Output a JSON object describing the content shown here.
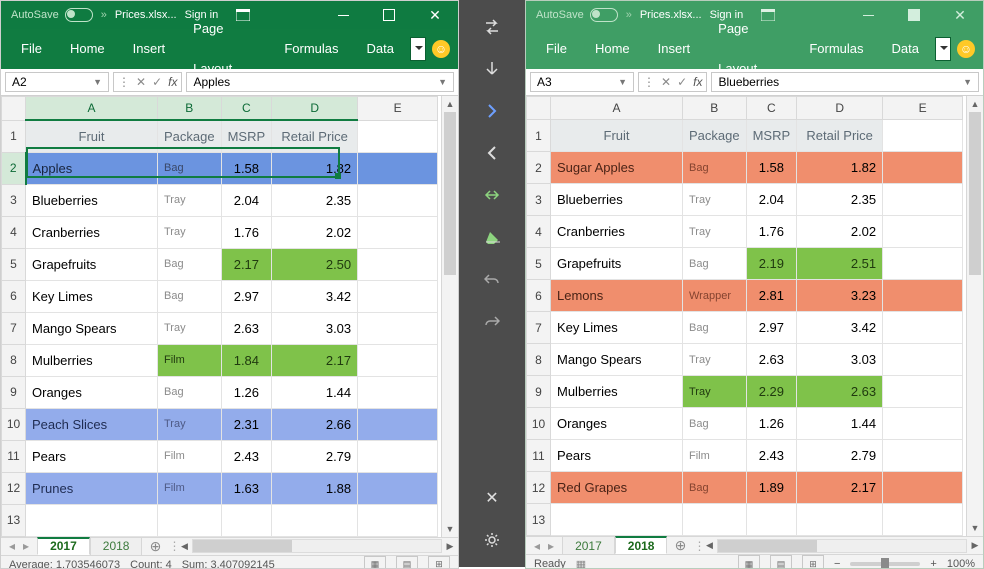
{
  "left": {
    "title": {
      "autosave": "AutoSave",
      "state": "Off",
      "file": "Prices.xlsx...",
      "signin": "Sign in"
    },
    "ribbon": [
      "File",
      "Home",
      "Insert",
      "Page Layout",
      "Formulas",
      "Data"
    ],
    "namebox": "A2",
    "formula": "Apples",
    "columns": [
      "A",
      "B",
      "C",
      "D",
      "E"
    ],
    "headers": [
      "Fruit",
      "Package",
      "MSRP",
      "Retail Price"
    ],
    "rows": [
      {
        "r": 2,
        "fruit": "Apples",
        "pkg": "Bag",
        "msrp": "1.58",
        "rp": "1.82",
        "hl": "blue-dark"
      },
      {
        "r": 3,
        "fruit": "Blueberries",
        "pkg": "Tray",
        "msrp": "2.04",
        "rp": "2.35"
      },
      {
        "r": 4,
        "fruit": "Cranberries",
        "pkg": "Tray",
        "msrp": "1.76",
        "rp": "2.02"
      },
      {
        "r": 5,
        "fruit": "Grapefruits",
        "pkg": "Bag",
        "msrp": "2.17",
        "rp": "2.50",
        "hlcells": [
          "msrp",
          "rp"
        ]
      },
      {
        "r": 6,
        "fruit": "Key Limes",
        "pkg": "Bag",
        "msrp": "2.97",
        "rp": "3.42"
      },
      {
        "r": 7,
        "fruit": "Mango Spears",
        "pkg": "Tray",
        "msrp": "2.63",
        "rp": "3.03"
      },
      {
        "r": 8,
        "fruit": "Mulberries",
        "pkg": "Film",
        "msrp": "1.84",
        "rp": "2.17",
        "hlcells": [
          "pkg",
          "msrp",
          "rp"
        ]
      },
      {
        "r": 9,
        "fruit": "Oranges",
        "pkg": "Bag",
        "msrp": "1.26",
        "rp": "1.44"
      },
      {
        "r": 10,
        "fruit": "Peach Slices",
        "pkg": "Tray",
        "msrp": "2.31",
        "rp": "2.66",
        "hl": "blue"
      },
      {
        "r": 11,
        "fruit": "Pears",
        "pkg": "Film",
        "msrp": "2.43",
        "rp": "2.79"
      },
      {
        "r": 12,
        "fruit": "Prunes",
        "pkg": "Film",
        "msrp": "1.63",
        "rp": "1.88",
        "hl": "blue"
      }
    ],
    "blank_rows": [
      13
    ],
    "tabs": [
      {
        "label": "2017",
        "active": true
      },
      {
        "label": "2018",
        "active": false
      }
    ],
    "status": {
      "avg": "Average: 1.703546073",
      "count": "Count: 4",
      "sum": "Sum: 3.407092145"
    }
  },
  "right": {
    "title": {
      "autosave": "AutoSave",
      "state": "Off",
      "file": "Prices.xlsx...",
      "signin": "Sign in"
    },
    "ribbon": [
      "File",
      "Home",
      "Insert",
      "Page Layout",
      "Formulas",
      "Data"
    ],
    "namebox": "A3",
    "formula": "Blueberries",
    "columns": [
      "A",
      "B",
      "C",
      "D",
      "E"
    ],
    "headers": [
      "Fruit",
      "Package",
      "MSRP",
      "Retail Price"
    ],
    "rows": [
      {
        "r": 2,
        "fruit": "Sugar Apples",
        "pkg": "Bag",
        "msrp": "1.58",
        "rp": "1.82",
        "hl": "orange"
      },
      {
        "r": 3,
        "fruit": "Blueberries",
        "pkg": "Tray",
        "msrp": "2.04",
        "rp": "2.35"
      },
      {
        "r": 4,
        "fruit": "Cranberries",
        "pkg": "Tray",
        "msrp": "1.76",
        "rp": "2.02"
      },
      {
        "r": 5,
        "fruit": "Grapefruits",
        "pkg": "Bag",
        "msrp": "2.19",
        "rp": "2.51",
        "hlcells": [
          "msrp",
          "rp"
        ]
      },
      {
        "r": 6,
        "fruit": "Lemons",
        "pkg": "Wrapper",
        "msrp": "2.81",
        "rp": "3.23",
        "hl": "orange"
      },
      {
        "r": 7,
        "fruit": "Key Limes",
        "pkg": "Bag",
        "msrp": "2.97",
        "rp": "3.42"
      },
      {
        "r": 8,
        "fruit": "Mango Spears",
        "pkg": "Tray",
        "msrp": "2.63",
        "rp": "3.03"
      },
      {
        "r": 9,
        "fruit": "Mulberries",
        "pkg": "Tray",
        "msrp": "2.29",
        "rp": "2.63",
        "hlcells": [
          "pkg",
          "msrp",
          "rp"
        ]
      },
      {
        "r": 10,
        "fruit": "Oranges",
        "pkg": "Bag",
        "msrp": "1.26",
        "rp": "1.44"
      },
      {
        "r": 11,
        "fruit": "Pears",
        "pkg": "Film",
        "msrp": "2.43",
        "rp": "2.79"
      },
      {
        "r": 12,
        "fruit": "Red Grapes",
        "pkg": "Bag",
        "msrp": "1.89",
        "rp": "2.17",
        "hl": "orange"
      }
    ],
    "blank_rows": [
      13
    ],
    "tabs": [
      {
        "label": "2017",
        "active": false
      },
      {
        "label": "2018",
        "active": true
      }
    ],
    "status": {
      "ready": "Ready",
      "zoom": "100%"
    }
  }
}
